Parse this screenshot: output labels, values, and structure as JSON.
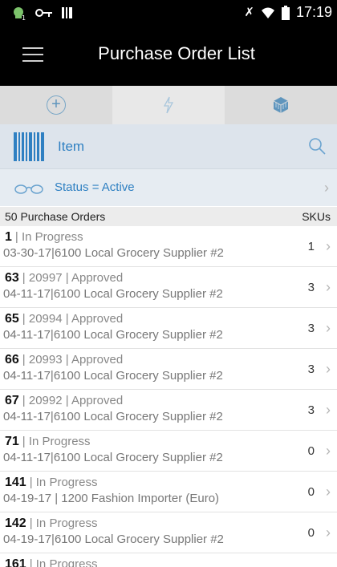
{
  "statusbar": {
    "time": "17:19"
  },
  "header": {
    "title": "Purchase Order List"
  },
  "tabs": [
    {
      "icon": "add-circle-icon",
      "active": false
    },
    {
      "icon": "lightning-icon",
      "active": true
    },
    {
      "icon": "cube-icon",
      "active": false
    }
  ],
  "search": {
    "label": "Item"
  },
  "filter": {
    "text": "Status = Active"
  },
  "list": {
    "count_label": "50 Purchase Orders",
    "skus_header": "SKUs",
    "rows": [
      {
        "line1_id": "1",
        "line1_rest": "|  In Progress",
        "line2": "03-30-17|6100 Local Grocery Supplier #2",
        "skus": "1"
      },
      {
        "line1_id": "63",
        "line1_rest": "|  20997  |  Approved",
        "line2": "04-11-17|6100 Local Grocery Supplier #2",
        "skus": "3"
      },
      {
        "line1_id": "65",
        "line1_rest": "|  20994  |  Approved",
        "line2": "04-11-17|6100 Local Grocery Supplier #2",
        "skus": "3"
      },
      {
        "line1_id": "66",
        "line1_rest": "|  20993  |  Approved",
        "line2": "04-11-17|6100 Local Grocery Supplier #2",
        "skus": "3"
      },
      {
        "line1_id": "67",
        "line1_rest": "|  20992  |  Approved",
        "line2": "04-11-17|6100 Local Grocery Supplier #2",
        "skus": "3"
      },
      {
        "line1_id": "71",
        "line1_rest": "|  In Progress",
        "line2": "04-11-17|6100 Local Grocery Supplier #2",
        "skus": "0"
      },
      {
        "line1_id": "141",
        "line1_rest": "|  In Progress",
        "line2": "04-19-17 | 1200 Fashion Importer (Euro)",
        "skus": "0"
      },
      {
        "line1_id": "142",
        "line1_rest": "|  In Progress",
        "line2": "04-19-17|6100 Local Grocery Supplier #2",
        "skus": "0"
      },
      {
        "line1_id": "161",
        "line1_rest": "|  In Progress",
        "line2": "",
        "skus": ""
      }
    ]
  }
}
